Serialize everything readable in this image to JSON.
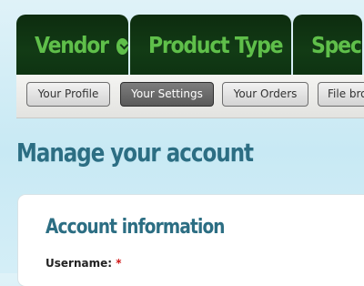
{
  "top_nav": {
    "tabs": [
      {
        "label": "Vendor",
        "icon": "chevron-down-icon"
      },
      {
        "label": "Product Type",
        "icon": "chevron-down-icon"
      },
      {
        "label": "Spec"
      }
    ],
    "colors": {
      "label": "#5fbf4a",
      "background": "#123b15"
    }
  },
  "sub_nav": {
    "items": [
      {
        "label": "Your Profile",
        "active": false
      },
      {
        "label": "Your Settings",
        "active": true
      },
      {
        "label": "Your Orders",
        "active": false
      },
      {
        "label": "File bro",
        "active": false
      }
    ]
  },
  "main": {
    "page_title": "Manage your account",
    "section_title": "Account information",
    "fields": [
      {
        "label": "Username:",
        "required_mark": "*"
      }
    ]
  },
  "colors": {
    "heading": "#2c6e83",
    "required": "#d01818"
  }
}
